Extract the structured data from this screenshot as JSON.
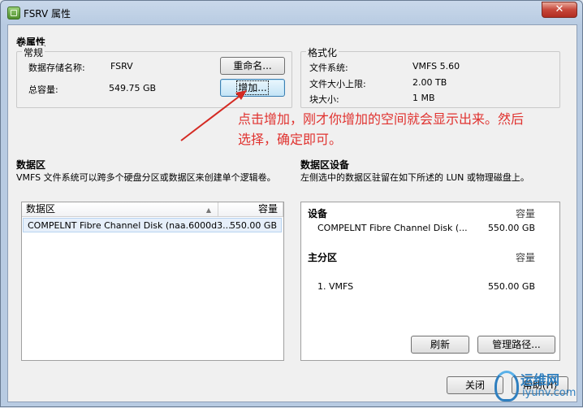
{
  "window": {
    "title": "FSRV 属性",
    "close_glyph": "✕"
  },
  "volume_properties": {
    "title": "卷属性",
    "general": {
      "label": "常规",
      "datastore_name_label": "数据存储名称:",
      "datastore_name_value": "FSRV",
      "total_capacity_label": "总容量:",
      "total_capacity_value": "549.75 GB",
      "rename_button": "重命名...",
      "increase_button": "增加..."
    },
    "format": {
      "label": "格式化",
      "filesystem_label": "文件系统:",
      "filesystem_value": "VMFS 5.60",
      "max_file_size_label": "文件大小上限:",
      "max_file_size_value": "2.00 TB",
      "block_size_label": "块大小:",
      "block_size_value": "1 MB"
    }
  },
  "annotation": {
    "line1": "点击增加，刚才你增加的空间就会显示出来。然后",
    "line2": "选择，确定即可。",
    "color": "#e0322f"
  },
  "extents": {
    "title": "数据区",
    "description": "VMFS 文件系统可以跨多个硬盘分区或数据区来创建单个逻辑卷。",
    "columns": [
      "数据区",
      "容量"
    ],
    "rows": [
      {
        "name": "COMPELNT Fibre Channel Disk (naa.6000d3...",
        "capacity": "550.00 GB"
      }
    ]
  },
  "extent_device": {
    "title": "数据区设备",
    "description": "左侧选中的数据区驻留在如下所述的 LUN 或物理磁盘上。",
    "device_header": "设备",
    "capacity_header": "容量",
    "device_name": "COMPELNT Fibre Channel Disk (...",
    "device_capacity": "550.00 GB",
    "primary_partition_header": "主分区",
    "partition_capacity_header": "容量",
    "partition_name": "1. VMFS",
    "partition_capacity": "550.00 GB",
    "refresh_button": "刷新",
    "manage_paths_button": "管理路径..."
  },
  "footer": {
    "close_button": "关闭",
    "help_button": "帮助(H)"
  },
  "watermark": {
    "line1": "运维网",
    "line2": "iyunv.com"
  }
}
